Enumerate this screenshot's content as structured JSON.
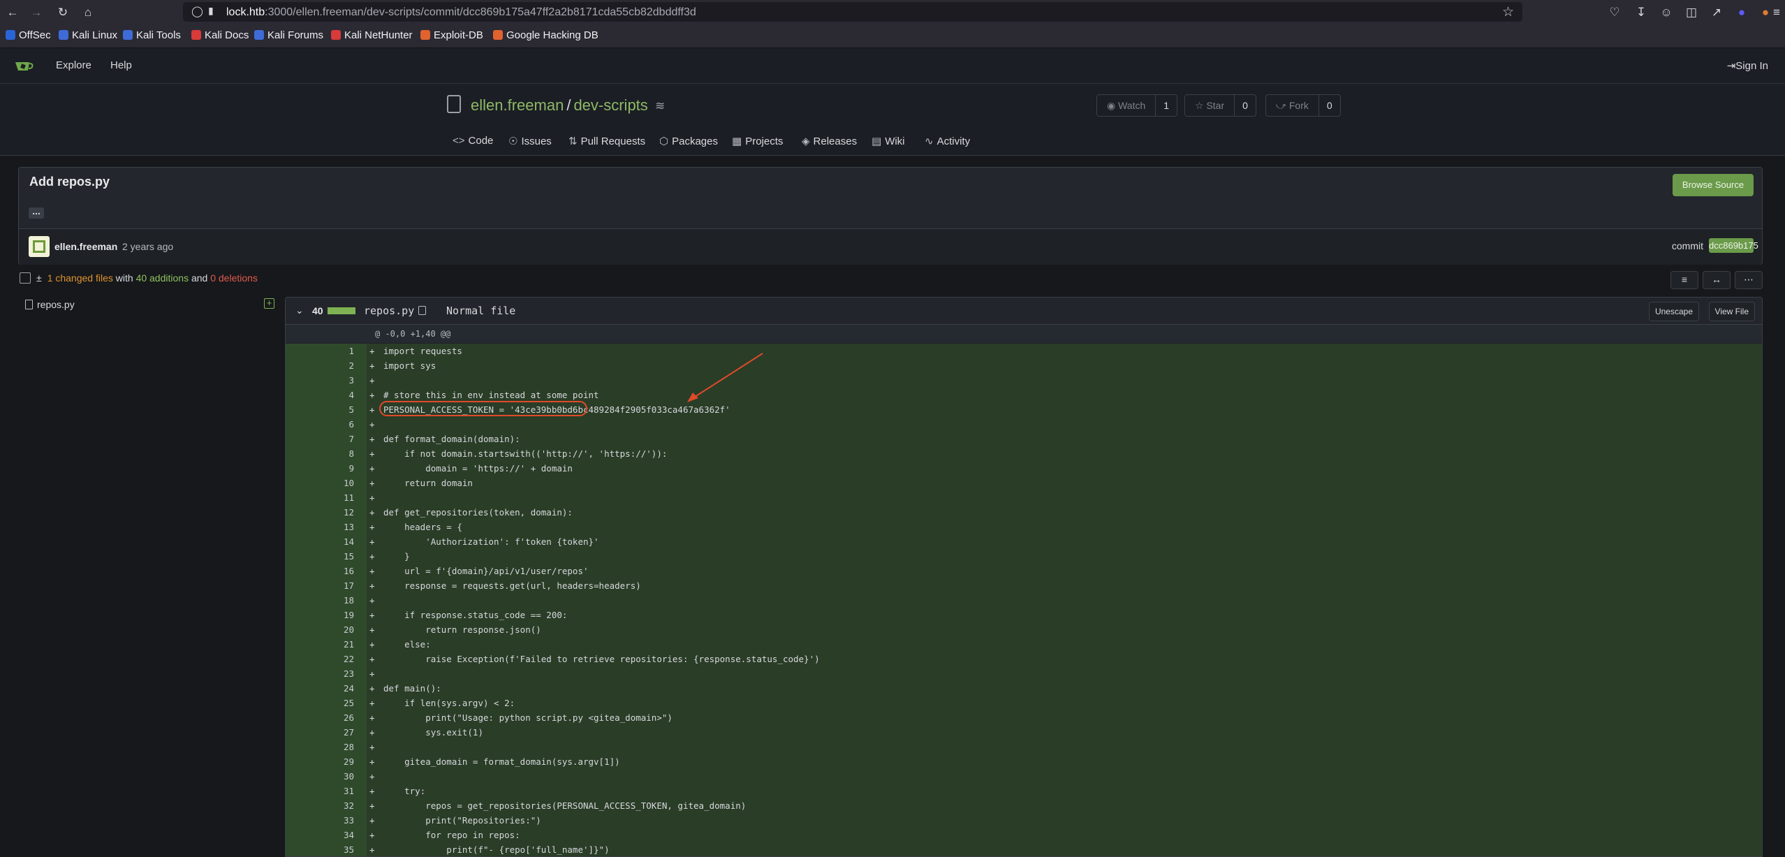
{
  "browser": {
    "url_host": "lock.htb",
    "url_path": ":3000/ellen.freeman/dev-scripts/commit/dcc869b175a47ff2a2b8171cda55cb82dbddff3d",
    "bookmarks": [
      {
        "label": "OffSec",
        "color": "#2b63d9"
      },
      {
        "label": "Kali Linux",
        "color": "#3e6bd6"
      },
      {
        "label": "Kali Tools",
        "color": "#3e6bd6"
      },
      {
        "label": "Kali Docs",
        "color": "#d93a3a"
      },
      {
        "label": "Kali Forums",
        "color": "#3e6bd6"
      },
      {
        "label": "Kali NetHunter",
        "color": "#d93a3a"
      },
      {
        "label": "Exploit-DB",
        "color": "#e0622e"
      },
      {
        "label": "Google Hacking DB",
        "color": "#e0622e"
      }
    ]
  },
  "topnav": {
    "explore": "Explore",
    "help": "Help",
    "signin": "Sign In"
  },
  "repo": {
    "owner": "ellen.freeman",
    "name": "dev-scripts",
    "sep": "/",
    "watch": "Watch",
    "watch_count": "1",
    "star": "Star",
    "star_count": "0",
    "fork": "Fork",
    "fork_count": "0",
    "tabs": [
      "Code",
      "Issues",
      "Pull Requests",
      "Packages",
      "Projects",
      "Releases",
      "Wiki",
      "Activity"
    ]
  },
  "commit": {
    "title": "Add repos.py",
    "browse": "Browse Source",
    "dots": "...",
    "author": "ellen.freeman",
    "ago": "2 years ago",
    "commit_label": "commit",
    "sha": "dcc869b175"
  },
  "diffstats": {
    "changed": "1 changed files",
    "with": "with",
    "additions": "40 additions",
    "and": "and",
    "deletions": "0 deletions"
  },
  "filetree": {
    "file": "repos.py"
  },
  "diff": {
    "count": "40",
    "filename": "repos.py",
    "filetype": "Normal file",
    "unescape": "Unescape",
    "viewfile": "View File",
    "hunk": "@ -0,0 +1,40 @@",
    "lines": [
      {
        "n": "1",
        "t": "import requests"
      },
      {
        "n": "2",
        "t": "import sys"
      },
      {
        "n": "3",
        "t": ""
      },
      {
        "n": "4",
        "t": "# store this in env instead at some point"
      },
      {
        "n": "5",
        "t": "PERSONAL_ACCESS_TOKEN = '43ce39bb0bd6bc489284f2905f033ca467a6362f'"
      },
      {
        "n": "6",
        "t": ""
      },
      {
        "n": "7",
        "t": "def format_domain(domain):"
      },
      {
        "n": "8",
        "t": "    if not domain.startswith(('http://', 'https://')):"
      },
      {
        "n": "9",
        "t": "        domain = 'https://' + domain"
      },
      {
        "n": "10",
        "t": "    return domain"
      },
      {
        "n": "11",
        "t": ""
      },
      {
        "n": "12",
        "t": "def get_repositories(token, domain):"
      },
      {
        "n": "13",
        "t": "    headers = {"
      },
      {
        "n": "14",
        "t": "        'Authorization': f'token {token}'"
      },
      {
        "n": "15",
        "t": "    }"
      },
      {
        "n": "16",
        "t": "    url = f'{domain}/api/v1/user/repos'"
      },
      {
        "n": "17",
        "t": "    response = requests.get(url, headers=headers)"
      },
      {
        "n": "18",
        "t": ""
      },
      {
        "n": "19",
        "t": "    if response.status_code == 200:"
      },
      {
        "n": "20",
        "t": "        return response.json()"
      },
      {
        "n": "21",
        "t": "    else:"
      },
      {
        "n": "22",
        "t": "        raise Exception(f'Failed to retrieve repositories: {response.status_code}')"
      },
      {
        "n": "23",
        "t": ""
      },
      {
        "n": "24",
        "t": "def main():"
      },
      {
        "n": "25",
        "t": "    if len(sys.argv) < 2:"
      },
      {
        "n": "26",
        "t": "        print(\"Usage: python script.py <gitea_domain>\")"
      },
      {
        "n": "27",
        "t": "        sys.exit(1)"
      },
      {
        "n": "28",
        "t": ""
      },
      {
        "n": "29",
        "t": "    gitea_domain = format_domain(sys.argv[1])"
      },
      {
        "n": "30",
        "t": ""
      },
      {
        "n": "31",
        "t": "    try:"
      },
      {
        "n": "32",
        "t": "        repos = get_repositories(PERSONAL_ACCESS_TOKEN, gitea_domain)"
      },
      {
        "n": "33",
        "t": "        print(\"Repositories:\")"
      },
      {
        "n": "34",
        "t": "        for repo in repos:"
      },
      {
        "n": "35",
        "t": "            print(f\"- {repo['full_name']}\")"
      }
    ]
  }
}
